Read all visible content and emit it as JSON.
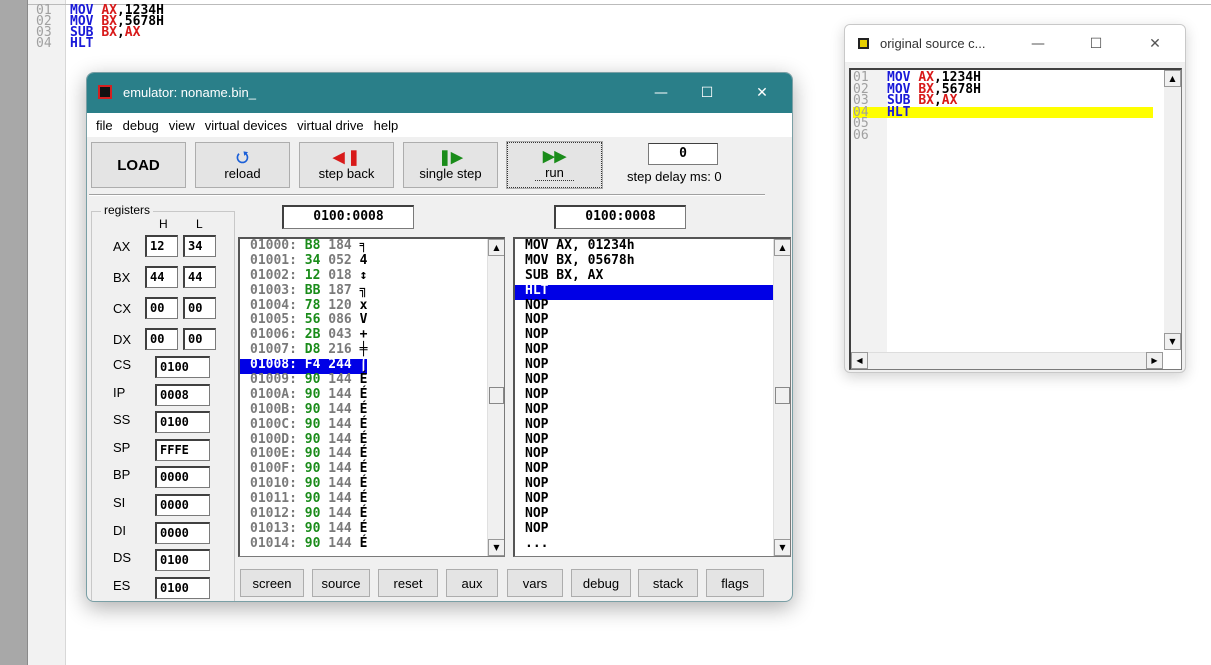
{
  "editor": {
    "lines": [
      {
        "n": "01",
        "op": "MOV",
        "a": "AX",
        "b": "1234H"
      },
      {
        "n": "02",
        "op": "MOV",
        "a": "BX",
        "b": "5678H"
      },
      {
        "n": "03",
        "op": "SUB",
        "a": "BX",
        "b": "AX"
      },
      {
        "n": "04",
        "op": "HLT",
        "a": "",
        "b": ""
      }
    ]
  },
  "emulator": {
    "title": "emulator: noname.bin_",
    "menu": [
      "file",
      "debug",
      "view",
      "virtual devices",
      "virtual drive",
      "help"
    ],
    "toolbar": {
      "load": "LOAD",
      "reload": "reload",
      "step_back": "step back",
      "single_step": "single step",
      "run": "run",
      "delay_value": "0",
      "delay_label": "step delay ms: 0"
    },
    "registers": {
      "legend": "registers",
      "h_header": "H",
      "l_header": "L",
      "byte_regs": [
        {
          "name": "AX",
          "h": "12",
          "l": "34"
        },
        {
          "name": "BX",
          "h": "44",
          "l": "44"
        },
        {
          "name": "CX",
          "h": "00",
          "l": "00"
        },
        {
          "name": "DX",
          "h": "00",
          "l": "00"
        }
      ],
      "word_regs": [
        {
          "name": "CS",
          "value": "0100"
        },
        {
          "name": "IP",
          "value": "0008"
        },
        {
          "name": "SS",
          "value": "0100"
        },
        {
          "name": "SP",
          "value": "FFFE"
        },
        {
          "name": "BP",
          "value": "0000"
        },
        {
          "name": "SI",
          "value": "0000"
        },
        {
          "name": "DI",
          "value": "0000"
        },
        {
          "name": "DS",
          "value": "0100"
        },
        {
          "name": "ES",
          "value": "0100"
        }
      ]
    },
    "mem_address": "0100:0008",
    "dis_address": "0100:0008",
    "memory": [
      {
        "addr": "01000:",
        "hex": "B8",
        "dec": "184",
        "chr": "╕"
      },
      {
        "addr": "01001:",
        "hex": "34",
        "dec": "052",
        "chr": "4"
      },
      {
        "addr": "01002:",
        "hex": "12",
        "dec": "018",
        "chr": "↕"
      },
      {
        "addr": "01003:",
        "hex": "BB",
        "dec": "187",
        "chr": "╗"
      },
      {
        "addr": "01004:",
        "hex": "78",
        "dec": "120",
        "chr": "x"
      },
      {
        "addr": "01005:",
        "hex": "56",
        "dec": "086",
        "chr": "V"
      },
      {
        "addr": "01006:",
        "hex": "2B",
        "dec": "043",
        "chr": "+"
      },
      {
        "addr": "01007:",
        "hex": "D8",
        "dec": "216",
        "chr": "╪"
      },
      {
        "addr": "01008:",
        "hex": "F4",
        "dec": "244",
        "chr": "⌠",
        "selected": true
      },
      {
        "addr": "01009:",
        "hex": "90",
        "dec": "144",
        "chr": "É"
      },
      {
        "addr": "0100A:",
        "hex": "90",
        "dec": "144",
        "chr": "É"
      },
      {
        "addr": "0100B:",
        "hex": "90",
        "dec": "144",
        "chr": "É"
      },
      {
        "addr": "0100C:",
        "hex": "90",
        "dec": "144",
        "chr": "É"
      },
      {
        "addr": "0100D:",
        "hex": "90",
        "dec": "144",
        "chr": "É"
      },
      {
        "addr": "0100E:",
        "hex": "90",
        "dec": "144",
        "chr": "É"
      },
      {
        "addr": "0100F:",
        "hex": "90",
        "dec": "144",
        "chr": "É"
      },
      {
        "addr": "01010:",
        "hex": "90",
        "dec": "144",
        "chr": "É"
      },
      {
        "addr": "01011:",
        "hex": "90",
        "dec": "144",
        "chr": "É"
      },
      {
        "addr": "01012:",
        "hex": "90",
        "dec": "144",
        "chr": "É"
      },
      {
        "addr": "01013:",
        "hex": "90",
        "dec": "144",
        "chr": "É"
      },
      {
        "addr": "01014:",
        "hex": "90",
        "dec": "144",
        "chr": "É"
      }
    ],
    "disassembly": [
      {
        "text": "MOV AX, 01234h"
      },
      {
        "text": "MOV BX, 05678h"
      },
      {
        "text": "SUB BX, AX"
      },
      {
        "text": "HLT",
        "selected": true
      },
      {
        "text": "NOP"
      },
      {
        "text": "NOP"
      },
      {
        "text": "NOP"
      },
      {
        "text": "NOP"
      },
      {
        "text": "NOP"
      },
      {
        "text": "NOP"
      },
      {
        "text": "NOP"
      },
      {
        "text": "NOP"
      },
      {
        "text": "NOP"
      },
      {
        "text": "NOP"
      },
      {
        "text": "NOP"
      },
      {
        "text": "NOP"
      },
      {
        "text": "NOP"
      },
      {
        "text": "NOP"
      },
      {
        "text": "NOP"
      },
      {
        "text": "NOP"
      },
      {
        "text": "..."
      }
    ],
    "bottom_buttons": [
      "screen",
      "source",
      "reset",
      "aux",
      "vars",
      "debug",
      "stack",
      "flags"
    ]
  },
  "source_window": {
    "title": "original source c...",
    "lines": [
      {
        "n": "01",
        "op": "MOV",
        "a": "AX",
        "b": "1234H"
      },
      {
        "n": "02",
        "op": "MOV",
        "a": "BX",
        "b": "5678H"
      },
      {
        "n": "03",
        "op": "SUB",
        "a": "BX",
        "b": "AX"
      },
      {
        "n": "04",
        "op": "HLT",
        "a": "",
        "b": "",
        "highlight": true
      },
      {
        "n": "05",
        "op": "",
        "a": "",
        "b": ""
      },
      {
        "n": "06",
        "op": "",
        "a": "",
        "b": ""
      }
    ]
  },
  "colors": {
    "titlebar": "#2a7f89",
    "selection": "#0000e6",
    "keyword": "#1a1ad8",
    "register": "#d81a1a",
    "hex_byte": "#1a8c1a",
    "source_highlight": "#ffff00"
  },
  "icons": {
    "emu_app": "chip-icon",
    "src_app": "chip-icon",
    "reload": "reload-icon",
    "step_back": "step-back-icon",
    "single_step": "single-step-icon",
    "run": "run-icon"
  }
}
